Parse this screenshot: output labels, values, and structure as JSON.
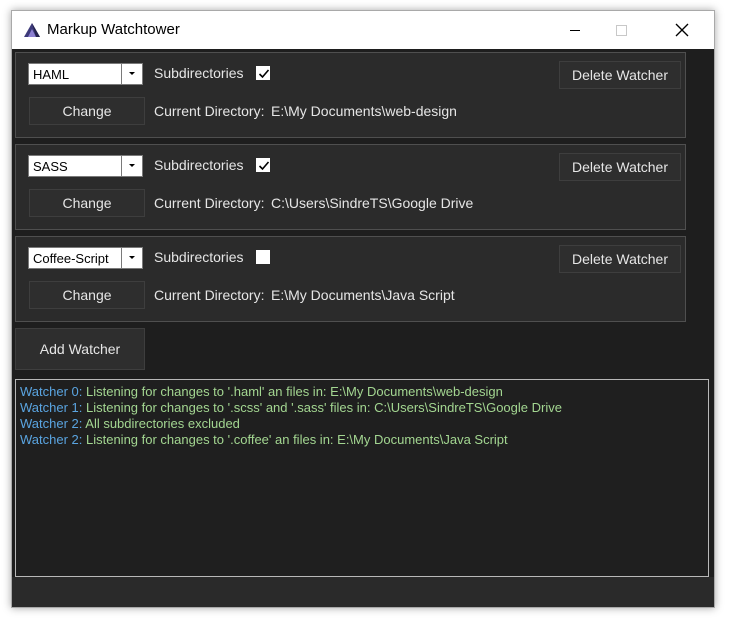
{
  "window": {
    "title": "Markup Watchtower"
  },
  "icons": {
    "app": "app-logo-icon",
    "minimize": "minimize-icon",
    "maximize": "maximize-icon",
    "close": "close-icon",
    "dropdown": "chevron-down-icon",
    "check": "checkmark-icon"
  },
  "watchers": [
    {
      "language": "HAML",
      "subdirectories_label": "Subdirectories",
      "subdirectories_checked": true,
      "delete_label": "Delete Watcher",
      "change_label": "Change",
      "dir_label": "Current Directory:",
      "dir_value": "E:\\My Documents\\web-design"
    },
    {
      "language": "SASS",
      "subdirectories_label": "Subdirectories",
      "subdirectories_checked": true,
      "delete_label": "Delete Watcher",
      "change_label": "Change",
      "dir_label": "Current Directory:",
      "dir_value": "C:\\Users\\SindreTS\\Google Drive"
    },
    {
      "language": "Coffee-Script",
      "subdirectories_label": "Subdirectories",
      "subdirectories_checked": false,
      "delete_label": "Delete Watcher",
      "change_label": "Change",
      "dir_label": "Current Directory:",
      "dir_value": "E:\\My Documents\\Java Script"
    }
  ],
  "add_watcher_label": "Add Watcher",
  "log": [
    {
      "prefix": "Watcher 0:",
      "message": " Listening for changes to '.haml' an files in: E:\\My Documents\\web-design"
    },
    {
      "prefix": "Watcher 1:",
      "message": " Listening for changes to '.scss' and '.sass' files in: C:\\Users\\SindreTS\\Google Drive"
    },
    {
      "prefix": "Watcher 2:",
      "message": " All subdirectories excluded"
    },
    {
      "prefix": "Watcher 2:",
      "message": " Listening for changes to '.coffee' an files in: E:\\My Documents\\Java Script"
    }
  ],
  "colors": {
    "background": "#1e1e1e",
    "panel": "#2b2b2b",
    "log_prefix": "#5aa4e0",
    "log_message": "#a3d691",
    "text": "#e6e6e6"
  }
}
